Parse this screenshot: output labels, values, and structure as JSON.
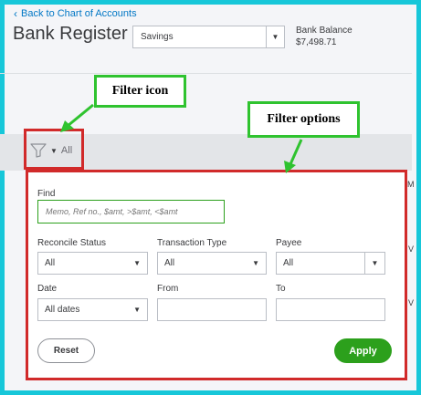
{
  "header": {
    "back_link": "Back to Chart of Accounts",
    "title": "Bank Register",
    "account_selected": "Savings",
    "bank_balance_label": "Bank Balance",
    "bank_balance_value": "$7,498.71"
  },
  "annotations": {
    "filter_icon": "Filter icon",
    "filter_options": "Filter options",
    "highlight_color": "#d12a2a",
    "callout_color": "#2fc32f"
  },
  "toolbar": {
    "filter_label": "All"
  },
  "filter_panel": {
    "find_label": "Find",
    "find_placeholder": "Memo, Ref no., $amt, >$amt, <$amt",
    "reconcile_status": {
      "label": "Reconcile Status",
      "value": "All"
    },
    "transaction_type": {
      "label": "Transaction Type",
      "value": "All"
    },
    "payee": {
      "label": "Payee",
      "value": "All"
    },
    "date": {
      "label": "Date",
      "value": "All dates"
    },
    "from_label": "From",
    "to_label": "To",
    "reset_label": "Reset",
    "apply_label": "Apply",
    "apply_color": "#2ca01c"
  },
  "background_edge": {
    "col_fragment": "M",
    "row_fragment_1": "V",
    "row_fragment_2": "V"
  }
}
